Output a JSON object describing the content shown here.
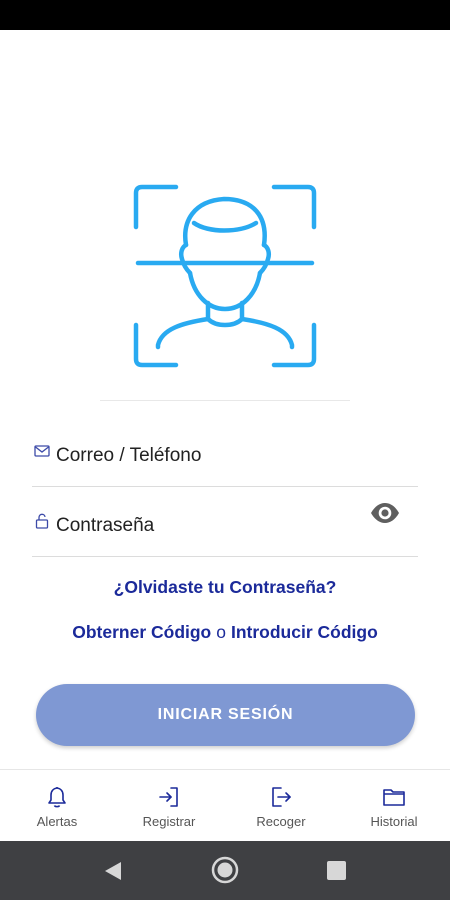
{
  "app": {
    "logo_icon": "face-scan-icon",
    "accent_color": "#29aaf1",
    "link_color": "#1b2a9a",
    "button_color": "#7f98d3"
  },
  "form": {
    "email": {
      "placeholder": "Correo / Teléfono",
      "icon": "mail-icon"
    },
    "password": {
      "placeholder": "Contraseña",
      "icon": "lock-icon",
      "toggle_icon": "eye-icon"
    },
    "forgot_password": "¿Olvidaste tu Contraseña?",
    "get_code": "Obterner Código",
    "separator": "o",
    "enter_code": "Introducir Código",
    "submit_label": "INICIAR SESIÓN"
  },
  "bottom_nav": {
    "items": [
      {
        "label": "Alertas",
        "icon": "bell-icon"
      },
      {
        "label": "Registrar",
        "icon": "login-icon"
      },
      {
        "label": "Recoger",
        "icon": "logout-icon"
      },
      {
        "label": "Historial",
        "icon": "folder-icon"
      }
    ]
  },
  "system_nav": {
    "items": [
      {
        "icon": "back-triangle-icon"
      },
      {
        "icon": "home-circle-icon"
      },
      {
        "icon": "recent-apps-square-icon"
      }
    ]
  }
}
